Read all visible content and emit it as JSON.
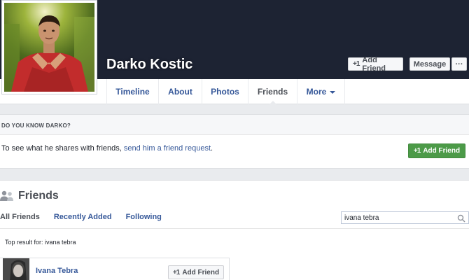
{
  "profile": {
    "name": "Darko Kostic",
    "add_friend_label": "Add Friend",
    "message_label": "Message",
    "more_label": "···"
  },
  "nav": {
    "tabs": [
      {
        "label": "Timeline"
      },
      {
        "label": "About"
      },
      {
        "label": "Photos"
      },
      {
        "label": "Friends"
      },
      {
        "label": "More"
      }
    ],
    "active_tab": "Friends"
  },
  "know": {
    "header": "DO YOU KNOW DARKO?",
    "text": "To see what he shares with friends, ",
    "link": "send him a friend request",
    "text_end": ".",
    "button_label": "Add Friend"
  },
  "friends": {
    "title": "Friends",
    "tabs": [
      {
        "label": "All Friends"
      },
      {
        "label": "Recently Added"
      },
      {
        "label": "Following"
      }
    ],
    "search_value": "ivana tebra",
    "top_result_text": "Top result for: ivana tebra",
    "results": [
      {
        "name": "Ivana Tebra",
        "button_label": "Add Friend"
      }
    ]
  },
  "colors": {
    "cover": "#1d2333",
    "link": "#365899",
    "green": "#4c9a48"
  }
}
